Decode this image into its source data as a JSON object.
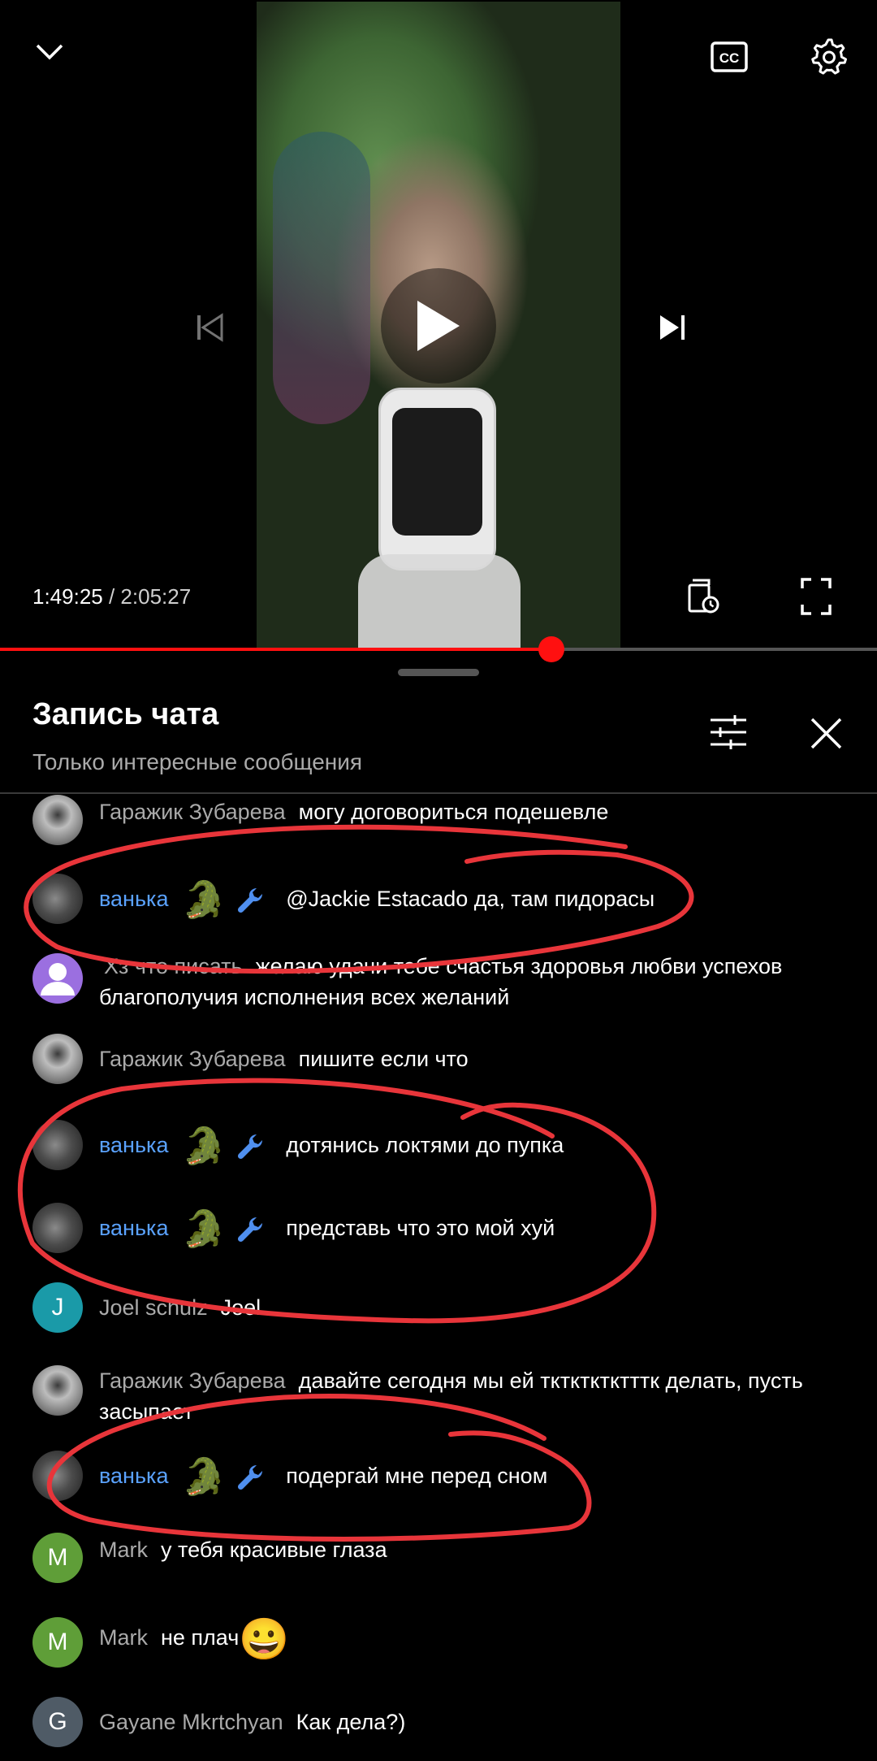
{
  "player": {
    "current_time": "1:49:25",
    "separator": " / ",
    "duration": "2:05:27",
    "progress_fraction": 0.629,
    "accent_color": "#ff1010",
    "icons": {
      "minimize": "chevron-down-icon",
      "captions": "cc-icon",
      "settings": "gear-icon",
      "previous": "skip-previous-icon",
      "play": "play-icon",
      "next": "skip-next-icon",
      "queue": "queue-icon",
      "fullscreen": "fullscreen-icon"
    }
  },
  "chat": {
    "title": "Запись чата",
    "subtitle": "Только интересные сообщения",
    "icons": {
      "filter": "sliders-icon",
      "close": "close-icon"
    },
    "messages": [
      {
        "author": "Гаражик Зубарева",
        "text": "могу договориться подешевле",
        "avatar": "cat"
      },
      {
        "author": "ванька",
        "badge": "🐊",
        "text": "@Jackie Estacado да, там пидорасы",
        "avatar": "croc"
      },
      {
        "author": "Хз что писать",
        "text": "желаю удачи тебе счастья здоровья любви успехов благополучия исполнения всех желаний",
        "avatar": "default"
      },
      {
        "author": "Гаражик Зубарева",
        "text": "пишите если что",
        "avatar": "cat"
      },
      {
        "author": "ванька",
        "badge": "🐊",
        "text": "дотянись локтями до пупка",
        "avatar": "croc"
      },
      {
        "author": "ванька",
        "badge": "🐊",
        "text": "представь что это мой хуй",
        "avatar": "croc"
      },
      {
        "author": "Joel schulz",
        "initial": "J",
        "text": "Joel",
        "avatar_color": "#1a9aa8"
      },
      {
        "author": "Гаражик Зубарева",
        "text": "давайте сегодня мы ей тктктктктттк делать, пусть засыпает",
        "avatar": "cat"
      },
      {
        "author": "ванька",
        "badge": "🐊",
        "text": "подергай мне перед сном",
        "avatar": "croc"
      },
      {
        "author": "Mark",
        "initial": "M",
        "text": "у тебя красивые глаза",
        "avatar_color": "#5f9e38"
      },
      {
        "author": "Mark",
        "initial": "M",
        "text": "не плач",
        "emoji": "😀",
        "avatar_color": "#5f9e38"
      },
      {
        "author": "Gayane Mkrtchyan",
        "initial": "G",
        "text": "Как дела?)",
        "avatar_color": "#4f5b66"
      }
    ]
  },
  "annotation_color": "#e8353a"
}
